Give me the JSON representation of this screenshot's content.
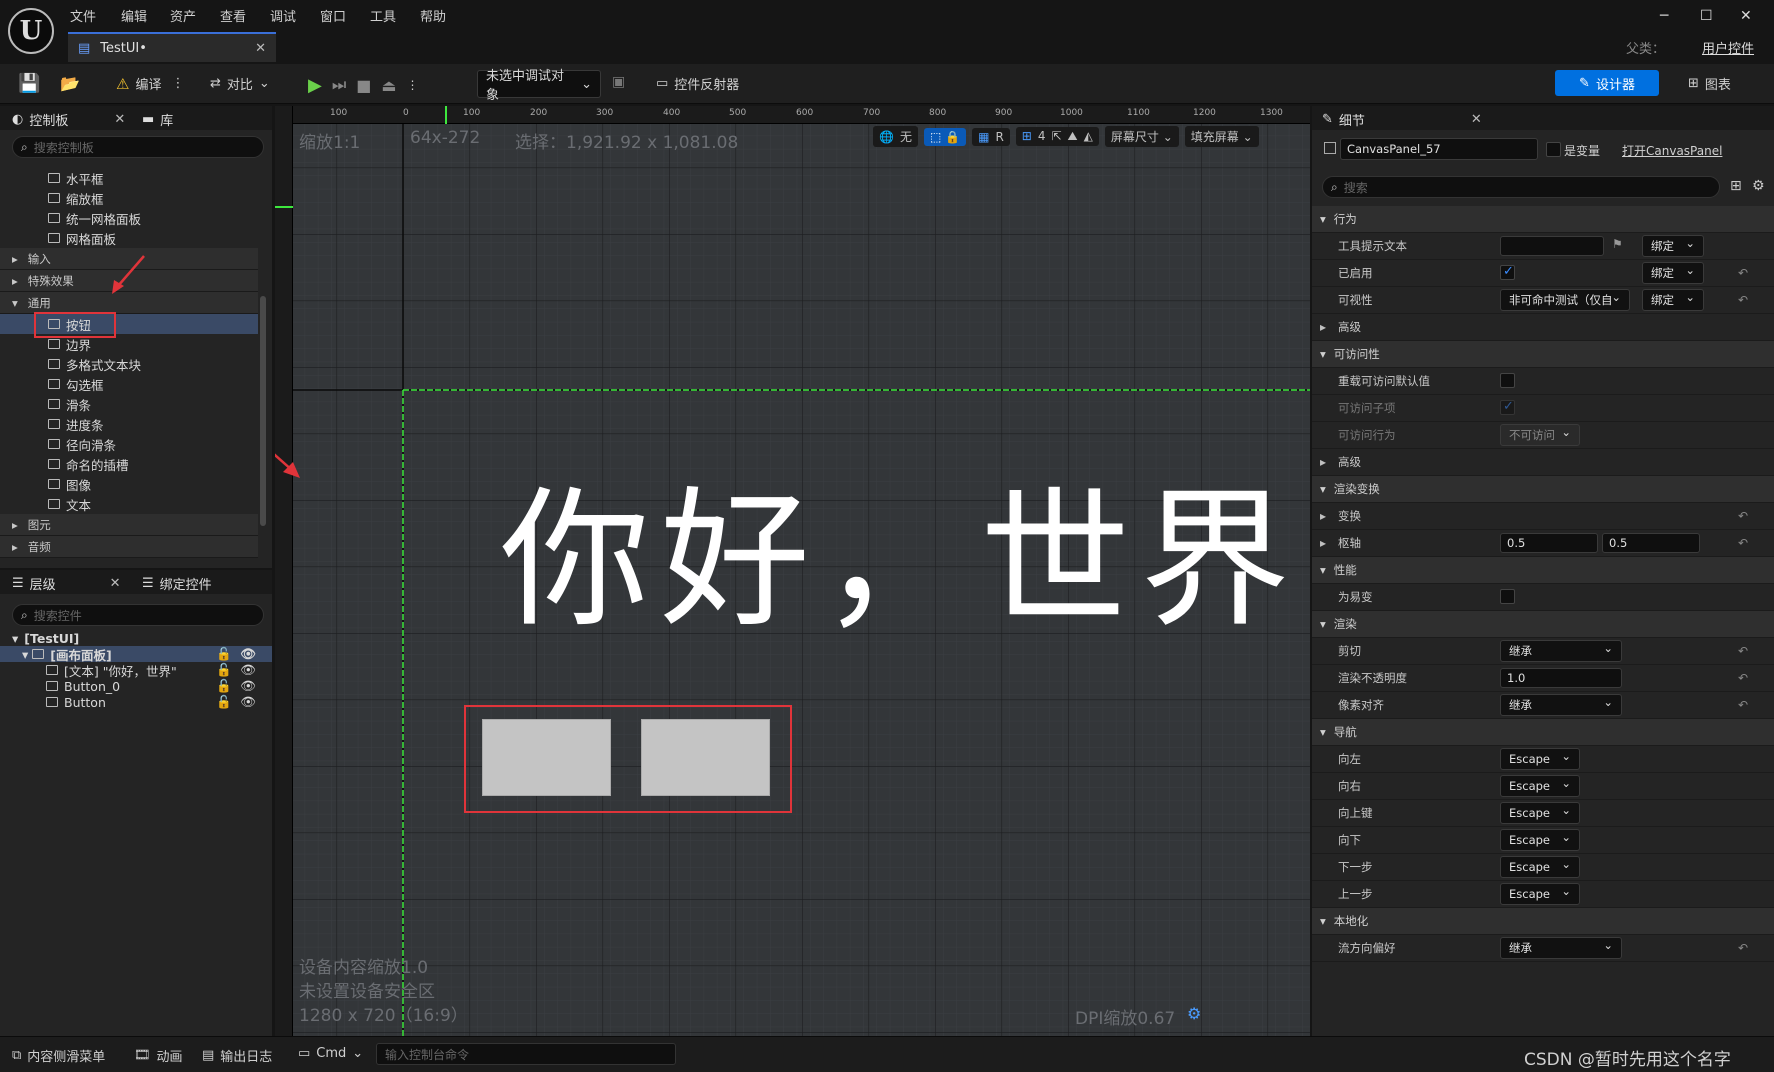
{
  "menu": [
    "文件",
    "编辑",
    "资产",
    "查看",
    "调试",
    "窗口",
    "工具",
    "帮助"
  ],
  "doc_tab": "TestUI•",
  "parent_label": "父类：",
  "parent_value": "用户控件",
  "toolbar": {
    "compile": "编译",
    "diff": "对比",
    "debug_target": "未选中调试对象",
    "widget_reflector": "控件反射器",
    "designer": "设计器",
    "graph": "图表"
  },
  "palette": {
    "tab": "控制板",
    "lib_tab": "库",
    "search_placeholder": "搜索控制板",
    "top_items": [
      "水平框",
      "缩放框",
      "统一网格面板",
      "网格面板"
    ],
    "categories_top": [
      "输入",
      "特殊效果",
      "通用"
    ],
    "common_items": [
      "按钮",
      "边界",
      "多格式文本块",
      "勾选框",
      "滑条",
      "进度条",
      "径向滑条",
      "命名的插槽",
      "图像",
      "文本"
    ],
    "categories_bottom": [
      "图元",
      "音频"
    ]
  },
  "hierarchy": {
    "tab": "层级",
    "bind_tab": "绑定控件",
    "search_placeholder": "搜索控件",
    "root": "[TestUI]",
    "canvas": "[画布面板]",
    "children": [
      "[文本] \"你好，世界\"",
      "Button_0",
      "Button"
    ]
  },
  "viewport": {
    "zoom": "缩放1:1",
    "coords": "64x-272",
    "selection": "选择：1,921.92 x 1,081.08",
    "none_label": "无",
    "r_label": "R",
    "grid_num": "4",
    "screen_size": "屏幕尺寸",
    "fill_screen": "填充屏幕",
    "ruler_labels": [
      "100",
      "0",
      "100",
      "200",
      "300",
      "400",
      "500",
      "600",
      "700",
      "800",
      "900",
      "1000",
      "1100",
      "1200",
      "1300"
    ],
    "canvas_text": "你好，世界",
    "device_scale": "设备内容缩放1.0",
    "safe_zone": "未设置设备安全区",
    "resolution": "1280 x 720（16:9）",
    "dpi": "DPI缩放0.67"
  },
  "details": {
    "tab": "细节",
    "name": "CanvasPanel_57",
    "is_variable": "是变量",
    "open": "打开CanvasPanel",
    "search_placeholder": "搜索",
    "sections": {
      "behavior": "行为",
      "tooltip": "工具提示文本",
      "bind": "绑定",
      "enabled": "已启用",
      "visibility": "可视性",
      "visibility_value": "非可命中测试（仅自",
      "advanced": "高级",
      "accessibility": "可访问性",
      "override_acc": "重载可访问默认值",
      "acc_children": "可访问子项",
      "acc_behavior": "可访问行为",
      "not_accessible": "不可访问",
      "advanced2": "高级",
      "render_transform": "渲染变换",
      "transform": "变换",
      "pivot": "枢轴",
      "pivot_x": "0.5",
      "pivot_y": "0.5",
      "performance": "性能",
      "volatile": "为易变",
      "rendering": "渲染",
      "clipping": "剪切",
      "inherit": "继承",
      "render_opacity": "渲染不透明度",
      "opacity_value": "1.0",
      "pixel_snapping": "像素对齐",
      "navigation": "导航",
      "nav_left": "向左",
      "nav_right": "向右",
      "nav_up": "向上键",
      "nav_down": "向下",
      "nav_next": "下一步",
      "nav_prev": "上一步",
      "escape": "Escape",
      "localization": "本地化",
      "flow_direction": "流方向偏好"
    }
  },
  "statusbar": {
    "content_drawer": "内容侧滑菜单",
    "animation": "动画",
    "output_log": "输出日志",
    "cmd": "Cmd",
    "console_placeholder": "输入控制台命令",
    "watermark": "CSDN @暂时先用这个名字"
  }
}
